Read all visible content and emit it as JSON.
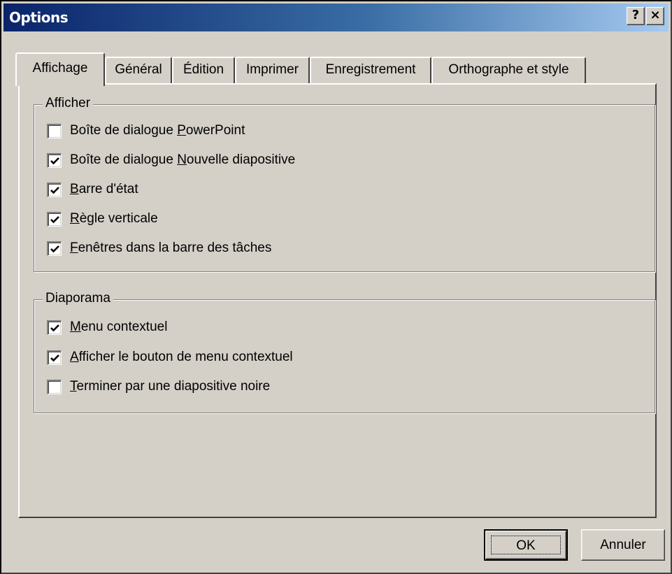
{
  "window": {
    "title": "Options",
    "help_button": "?",
    "close_button": "×"
  },
  "tabs": [
    {
      "label": "Affichage",
      "active": true
    },
    {
      "label": "Général",
      "active": false
    },
    {
      "label": "Édition",
      "active": false
    },
    {
      "label": "Imprimer",
      "active": false
    },
    {
      "label": "Enregistrement",
      "active": false
    },
    {
      "label": "Orthographe et style",
      "active": false
    }
  ],
  "afficher": {
    "legend": "Afficher",
    "items": [
      {
        "pre": "Boîte de dialogue ",
        "key": "P",
        "post": "owerPoint",
        "checked": false
      },
      {
        "pre": "Boîte de dialogue ",
        "key": "N",
        "post": "ouvelle diapositive",
        "checked": true
      },
      {
        "pre": "",
        "key": "B",
        "post": "arre d'état",
        "checked": true
      },
      {
        "pre": "",
        "key": "R",
        "post": "ègle verticale",
        "checked": true
      },
      {
        "pre": "",
        "key": "F",
        "post": "enêtres dans la barre des tâches",
        "checked": true
      }
    ]
  },
  "diaporama": {
    "legend": "Diaporama",
    "items": [
      {
        "pre": "",
        "key": "M",
        "post": "enu contextuel",
        "checked": true
      },
      {
        "pre": "",
        "key": "A",
        "post": "fficher le bouton de menu contextuel",
        "checked": true
      },
      {
        "pre": "",
        "key": "T",
        "post": "erminer par une diapositive noire",
        "checked": false
      }
    ]
  },
  "buttons": {
    "ok": "OK",
    "cancel": "Annuler"
  },
  "colors": {
    "titlebar_start": "#0a246a",
    "titlebar_end": "#a6caf0",
    "face": "#d4d0c8"
  }
}
